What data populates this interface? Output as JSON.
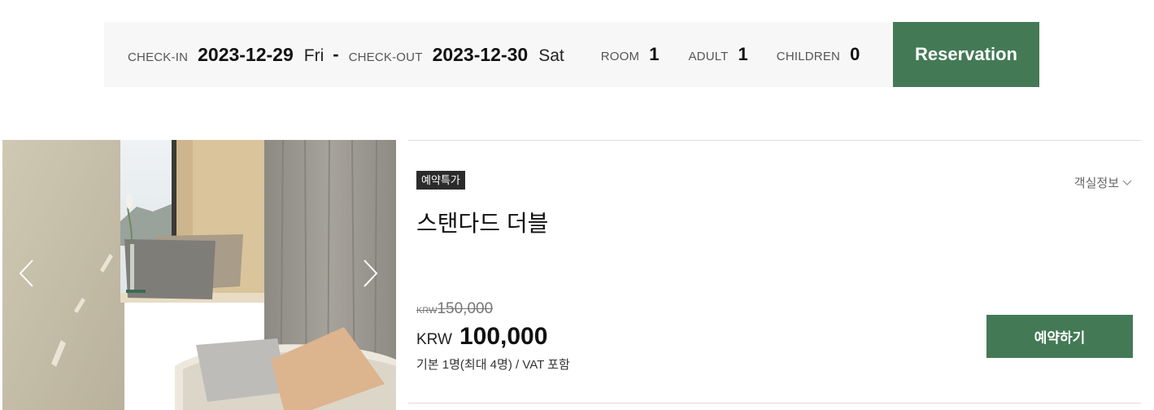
{
  "search": {
    "checkin_label": "CHECK-IN",
    "checkin_date": "2023-12-29",
    "checkin_day": "Fri",
    "separator": "-",
    "checkout_label": "CHECK-OUT",
    "checkout_date": "2023-12-30",
    "checkout_day": "Sat",
    "room_label": "ROOM",
    "room_count": "1",
    "adult_label": "ADULT",
    "adult_count": "1",
    "children_label": "CHILDREN",
    "children_count": "0",
    "reserve_label": "Reservation"
  },
  "room": {
    "badge": "예약특가",
    "title": "스탠다드 더블",
    "detail_link": "객실정보",
    "original_currency": "KRW",
    "original_price": "150,000",
    "currency": "KRW",
    "price": "100,000",
    "note": "기본 1명(최대 4명) / VAT 포함",
    "book_label": "예약하기"
  },
  "colors": {
    "accent": "#437a55",
    "search_bg": "#f7f7f7",
    "badge_bg": "#2b2b2b"
  },
  "icons": {
    "prev": "chevron-left-icon",
    "next": "chevron-right-icon",
    "detail": "chevron-down-icon"
  }
}
